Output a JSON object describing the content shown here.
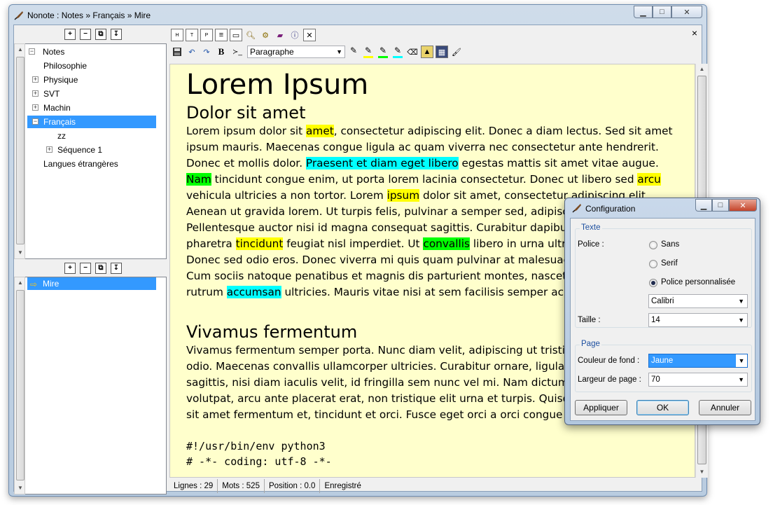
{
  "window": {
    "title": "Nonote : Notes » Français » Mire",
    "caption_buttons": [
      "minimize",
      "maximize",
      "close"
    ]
  },
  "tree_toolbar": {
    "icons": [
      "add-folder-icon",
      "remove-folder-icon",
      "copy-folder-icon",
      "paste-folder-icon"
    ]
  },
  "tree": {
    "items": [
      {
        "label": "Notes",
        "expander": "−",
        "level": 0
      },
      {
        "label": "Philosophie",
        "expander": "",
        "level": 1
      },
      {
        "label": "Physique",
        "expander": "+",
        "level": 1
      },
      {
        "label": "SVT",
        "expander": "+",
        "level": 1
      },
      {
        "label": "Machin",
        "expander": "+",
        "level": 1
      },
      {
        "label": "Français",
        "expander": "−",
        "level": 1,
        "selected": true
      },
      {
        "label": "zz",
        "expander": "",
        "level": 2
      },
      {
        "label": "Séquence 1",
        "expander": "+",
        "level": 2
      },
      {
        "label": "Langues étrangères",
        "expander": "",
        "level": 1
      }
    ]
  },
  "notes_toolbar": {
    "icons": [
      "add-note-icon",
      "remove-note-icon",
      "copy-note-icon",
      "paste-note-icon"
    ]
  },
  "notes_list": {
    "items": [
      {
        "label": "Mire",
        "selected": true
      }
    ]
  },
  "toolbar_top": {
    "icons": [
      "export-html-icon",
      "export-txt-icon",
      "export-pdf-icon",
      "document-icon",
      "fullscreen-icon",
      "search-icon",
      "settings-icon",
      "book-icon",
      "info-icon",
      "close-note-icon"
    ],
    "close_label": "×"
  },
  "toolbar_format": {
    "save": "save-icon",
    "undo": "↶",
    "redo": "↷",
    "bold": "B",
    "code": "≻_",
    "paragraph_style": "Paragraphe",
    "highlight_colors": [
      "#ffff00",
      "#00ff00",
      "#00ffff"
    ]
  },
  "document": {
    "title": "Lorem Ipsum",
    "section1": {
      "heading": "Dolor sit amet",
      "lines": [
        [
          {
            "t": "Lorem ipsum dolor sit "
          },
          {
            "t": "amet",
            "hl": "y"
          },
          {
            "t": ", consectetur adipiscing elit. Donec a diam lectus. Sed sit amet"
          }
        ],
        [
          {
            "t": "ipsum mauris. Maecenas congue ligula ac quam viverra nec consectetur ante hendrerit."
          }
        ],
        [
          {
            "t": "Donec et mollis dolor. "
          },
          {
            "t": "Praesent et diam eget libero",
            "hl": "c"
          },
          {
            "t": " egestas mattis sit amet vitae augue."
          }
        ],
        [
          {
            "t": "Nam",
            "hl": "g"
          },
          {
            "t": " tincidunt congue enim, ut porta lorem lacinia consectetur. Donec ut libero sed "
          },
          {
            "t": "arcu",
            "hl": "y"
          }
        ],
        [
          {
            "t": "vehicula ultricies a non tortor. Lorem "
          },
          {
            "t": "ipsum",
            "hl": "y"
          },
          {
            "t": " dolor sit amet, consectetur adipiscing elit."
          }
        ],
        [
          {
            "t": "Aenean ut gravida lorem. Ut turpis felis, pulvinar a semper sed, adipiscing id dolor."
          }
        ],
        [
          {
            "t": "Pellentesque auctor nisi id magna consequat sagittis. Curabitur dapibus enim sit amet elit"
          }
        ],
        [
          {
            "t": "pharetra "
          },
          {
            "t": "tincidunt",
            "hl": "y"
          },
          {
            "t": " feugiat nisl imperdiet. Ut "
          },
          {
            "t": "convallis",
            "hl": "g"
          },
          {
            "t": " libero in urna ultrices accumsan."
          }
        ],
        [
          {
            "t": "Donec sed odio eros. Donec viverra mi quis quam pulvinar at malesuada arcu rhoncus."
          }
        ],
        [
          {
            "t": "Cum sociis natoque penatibus et magnis dis parturient montes, nascetur ridiculus mus. In"
          }
        ],
        [
          {
            "t": "rutrum "
          },
          {
            "t": "accumsan",
            "hl": "c"
          },
          {
            "t": " ultricies. Mauris vitae nisi at sem facilisis semper ac in est."
          }
        ]
      ]
    },
    "section2": {
      "heading": "Vivamus fermentum",
      "lines": [
        "Vivamus fermentum semper porta. Nunc diam velit, adipiscing ut tristique vitae, sagittis vel",
        "odio. Maecenas convallis ullamcorper ultricies. Curabitur ornare, ligula semper consectetur",
        "sagittis, nisi diam iaculis velit, id fringilla sem nunc vel mi. Nam dictum, odio nec pretium",
        "volutpat, arcu ante placerat erat, non tristique elit urna et turpis. Quisque mi metus, ornare",
        "sit amet fermentum et, tincidunt et orci. Fusce eget orci a orci congue vestibulum."
      ]
    },
    "code": [
      "#!/usr/bin/env python3",
      "# -*- coding: utf-8 -*-"
    ]
  },
  "status": {
    "lines_label": "Lignes : 29",
    "words_label": "Mots : 525",
    "position_label": "Position : 0.0",
    "state": "Enregistré"
  },
  "dialog": {
    "title": "Configuration",
    "text_group": {
      "title": "Texte",
      "font_label": "Police :",
      "options": [
        "Sans",
        "Serif",
        "Police personnalisée"
      ],
      "selected_option": 2,
      "font_value": "Calibri",
      "size_label": "Taille :",
      "size_value": "14"
    },
    "page_group": {
      "title": "Page",
      "bg_label": "Couleur de fond :",
      "bg_value": "Jaune",
      "width_label": "Largeur de page :",
      "width_value": "70"
    },
    "buttons": {
      "apply": "Appliquer",
      "ok": "OK",
      "cancel": "Annuler"
    }
  }
}
